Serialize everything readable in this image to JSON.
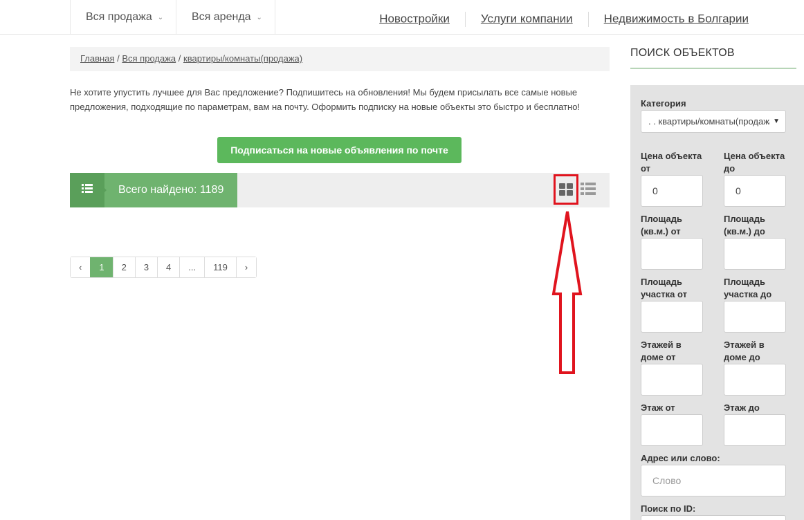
{
  "nav": {
    "dropdowns": [
      "Вся продажа",
      "Вся аренда"
    ],
    "links": [
      "Новостройки",
      "Услуги компании",
      "Недвижимость в Болгарии"
    ]
  },
  "breadcrumb": {
    "home": "Главная",
    "sep": "/",
    "sale": "Вся продажа",
    "current": "квартиры/комнаты(продажа)"
  },
  "promo_text": "Не хотите упустить лучшее для Вас предложение? Подпишитесь на обновления! Мы будем присылать все самые новые предложения, подходящие по параметрам, вам на почту. Оформить подписку на новые объекты это быстро и бесплатно!",
  "subscribe_label": "Подписаться на новые объявления по почте",
  "results": {
    "count_text": "Всего найдено: 1189",
    "highlight_color": "#e0141e"
  },
  "pagination": [
    "‹",
    "1",
    "2",
    "3",
    "4",
    "...",
    "119",
    "›"
  ],
  "pagination_active": "1",
  "sidebar": {
    "title": "ПОИСК ОБЪЕКТОВ",
    "category_label": "Категория",
    "category_value": ". . квартиры/комнаты(продажа)",
    "price_from_label": "Цена объекта от",
    "price_to_label": "Цена объекта до",
    "price_from_value": "0",
    "price_to_value": "0",
    "area_from_label": "Площадь (кв.м.) от",
    "area_to_label": "Площадь (кв.м.) до",
    "plot_from_label": "Площадь участка от",
    "plot_to_label": "Площадь участка до",
    "floors_from_label": "Этажей в доме от",
    "floors_to_label": "Этажей в доме до",
    "floor_from_label": "Этаж от",
    "floor_to_label": "Этаж до",
    "address_label": "Адрес или слово:",
    "address_placeholder": "Слово",
    "id_label": "Поиск по ID:"
  },
  "colors": {
    "green": "#5cb85c",
    "dark_green": "#5a9f5a",
    "light_green": "#6fb36f"
  }
}
